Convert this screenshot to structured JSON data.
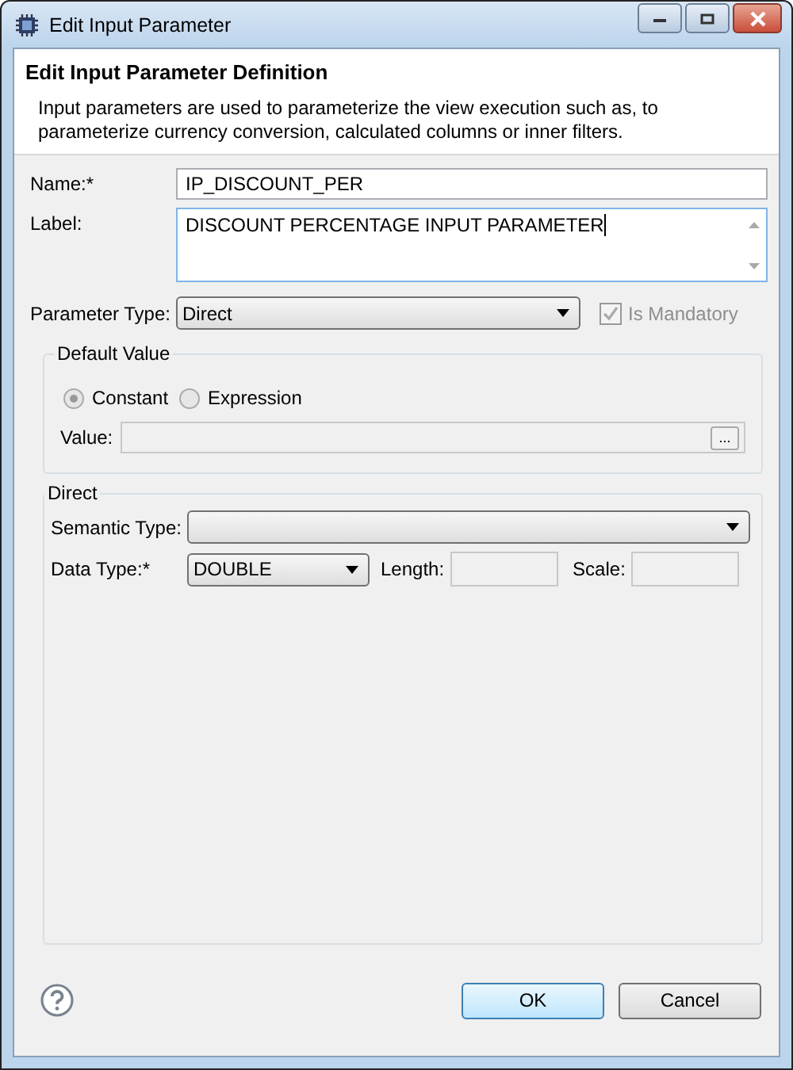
{
  "window": {
    "title": "Edit Input Parameter"
  },
  "header": {
    "title": "Edit Input Parameter Definition",
    "description": "Input parameters are used to parameterize the view execution such as, to parameterize currency conversion, calculated columns or inner filters."
  },
  "name": {
    "label": "Name:*",
    "value": "IP_DISCOUNT_PER"
  },
  "label_field": {
    "label": "Label:",
    "value": "DISCOUNT PERCENTAGE INPUT PARAMETER"
  },
  "parameter_type": {
    "label": "Parameter Type:",
    "value": "Direct"
  },
  "is_mandatory": {
    "label": "Is Mandatory",
    "checked": true,
    "disabled": true
  },
  "default_value": {
    "title": "Default Value",
    "options": [
      {
        "label": "Constant",
        "selected": true
      },
      {
        "label": "Expression",
        "selected": false
      }
    ],
    "value_label": "Value:",
    "browse": "..."
  },
  "direct": {
    "title": "Direct",
    "semantic_type_label": "Semantic Type:",
    "data_type_label": "Data Type:*",
    "data_type": "DOUBLE",
    "length_label": "Length:",
    "scale_label": "Scale:"
  },
  "buttons": [
    {
      "label": "OK",
      "default": true
    },
    {
      "label": "Cancel",
      "default": false
    }
  ]
}
